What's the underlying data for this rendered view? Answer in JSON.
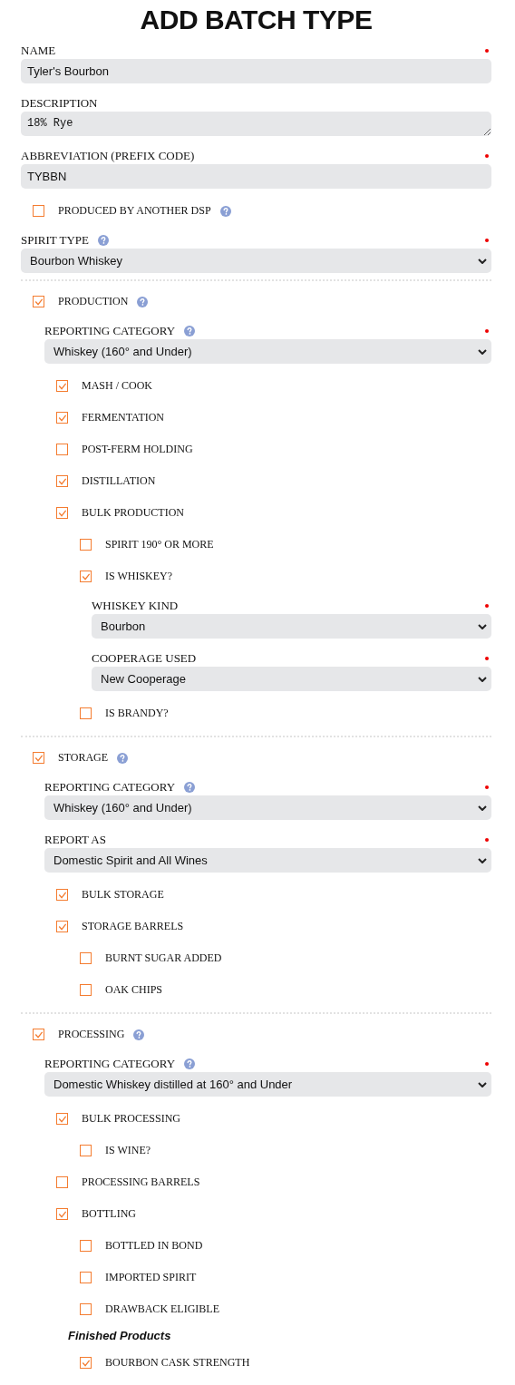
{
  "title": "ADD BATCH TYPE",
  "form": [
    {
      "kind": "text",
      "label": "NAME",
      "required": true,
      "value": "Tyler's Bourbon"
    },
    {
      "kind": "textarea",
      "label": "DESCRIPTION",
      "value": "18% Rye"
    },
    {
      "kind": "text",
      "label": "ABBREVIATION (PREFIX CODE)",
      "required": true,
      "value": "TYBBN"
    },
    {
      "kind": "checkbox",
      "label": "PRODUCED BY ANOTHER DSP",
      "checked": false,
      "help": true
    },
    {
      "kind": "select",
      "label": "SPIRIT TYPE",
      "help": true,
      "required": true,
      "value": "Bourbon Whiskey"
    },
    {
      "kind": "section",
      "label": "PRODUCTION",
      "checked": true,
      "help": true,
      "children": [
        {
          "kind": "select",
          "label": "REPORTING CATEGORY",
          "help": true,
          "required": true,
          "value": "Whiskey (160° and Under)"
        },
        {
          "kind": "checkbox",
          "label": "MASH / COOK",
          "checked": true
        },
        {
          "kind": "checkbox",
          "label": "FERMENTATION",
          "checked": true
        },
        {
          "kind": "checkbox",
          "label": "POST-FERM HOLDING",
          "checked": false
        },
        {
          "kind": "checkbox",
          "label": "DISTILLATION",
          "checked": true
        },
        {
          "kind": "checkbox",
          "label": "BULK PRODUCTION",
          "checked": true,
          "children": [
            {
              "kind": "checkbox",
              "label": "SPIRIT 190° OR MORE",
              "checked": false
            },
            {
              "kind": "checkbox",
              "label": "IS WHISKEY?",
              "checked": true,
              "children": [
                {
                  "kind": "select",
                  "label": "WHISKEY KIND",
                  "required": true,
                  "value": "Bourbon"
                },
                {
                  "kind": "select",
                  "label": "COOPERAGE USED",
                  "required": true,
                  "value": "New Cooperage"
                }
              ]
            },
            {
              "kind": "checkbox",
              "label": "IS BRANDY?",
              "checked": false
            }
          ]
        }
      ]
    },
    {
      "kind": "section",
      "label": "STORAGE",
      "checked": true,
      "help": true,
      "children": [
        {
          "kind": "select",
          "label": "REPORTING CATEGORY",
          "help": true,
          "required": true,
          "value": "Whiskey (160° and Under)"
        },
        {
          "kind": "select",
          "label": "REPORT AS",
          "required": true,
          "value": "Domestic Spirit and All Wines"
        },
        {
          "kind": "checkbox",
          "label": "BULK STORAGE",
          "checked": true
        },
        {
          "kind": "checkbox",
          "label": "STORAGE BARRELS",
          "checked": true,
          "children": [
            {
              "kind": "checkbox",
              "label": "BURNT SUGAR ADDED",
              "checked": false
            },
            {
              "kind": "checkbox",
              "label": "OAK CHIPS",
              "checked": false
            }
          ]
        }
      ]
    },
    {
      "kind": "section",
      "label": "PROCESSING",
      "checked": true,
      "help": true,
      "children": [
        {
          "kind": "select",
          "label": "REPORTING CATEGORY",
          "help": true,
          "required": true,
          "value": "Domestic Whiskey distilled at 160° and Under"
        },
        {
          "kind": "checkbox",
          "label": "BULK PROCESSING",
          "checked": true,
          "children": [
            {
              "kind": "checkbox",
              "label": "IS WINE?",
              "checked": false
            }
          ]
        },
        {
          "kind": "checkbox",
          "label": "PROCESSING BARRELS",
          "checked": false
        },
        {
          "kind": "checkbox",
          "label": "BOTTLING",
          "checked": true,
          "children": [
            {
              "kind": "checkbox",
              "label": "BOTTLED IN BOND",
              "checked": false
            },
            {
              "kind": "checkbox",
              "label": "IMPORTED SPIRIT",
              "checked": false
            },
            {
              "kind": "checkbox",
              "label": "DRAWBACK ELIGIBLE",
              "checked": false
            },
            {
              "kind": "heading",
              "label": "Finished Products"
            },
            {
              "kind": "checkbox",
              "label": "BOURBON CASK STRENGTH",
              "checked": true
            }
          ]
        }
      ]
    }
  ]
}
